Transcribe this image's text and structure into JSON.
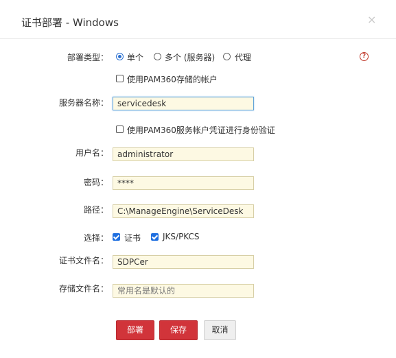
{
  "dialog": {
    "title": "证书部署 - Windows",
    "close_glyph": "×",
    "help_glyph": "?"
  },
  "deploy_type": {
    "label": "部署类型：",
    "options": [
      "单个",
      "多个 (服务器)",
      "代理"
    ],
    "selected": "单个"
  },
  "use_pam_account": {
    "label": "使用PAM360存储的帐户",
    "checked": false
  },
  "server_name": {
    "label": "服务器名称：",
    "value": "servicedesk"
  },
  "use_pam_service_account": {
    "label": "使用PAM360服务帐户凭证进行身份验证",
    "checked": false
  },
  "username": {
    "label": "用户名：",
    "value": "administrator"
  },
  "password": {
    "label": "密码：",
    "value": "****"
  },
  "path": {
    "label": "路径：",
    "value": "C:\\ManageEngine\\ServiceDesk"
  },
  "select": {
    "label": "选择：",
    "options": [
      {
        "label": "证书",
        "checked": true
      },
      {
        "label": "JKS/PKCS",
        "checked": true
      }
    ]
  },
  "cert_filename": {
    "label": "证书文件名：",
    "value": "SDPCer"
  },
  "store_filename": {
    "label": "存储文件名：",
    "placeholder": "常用名是默认的"
  },
  "buttons": {
    "deploy": "部署",
    "save": "保存",
    "cancel": "取消"
  }
}
